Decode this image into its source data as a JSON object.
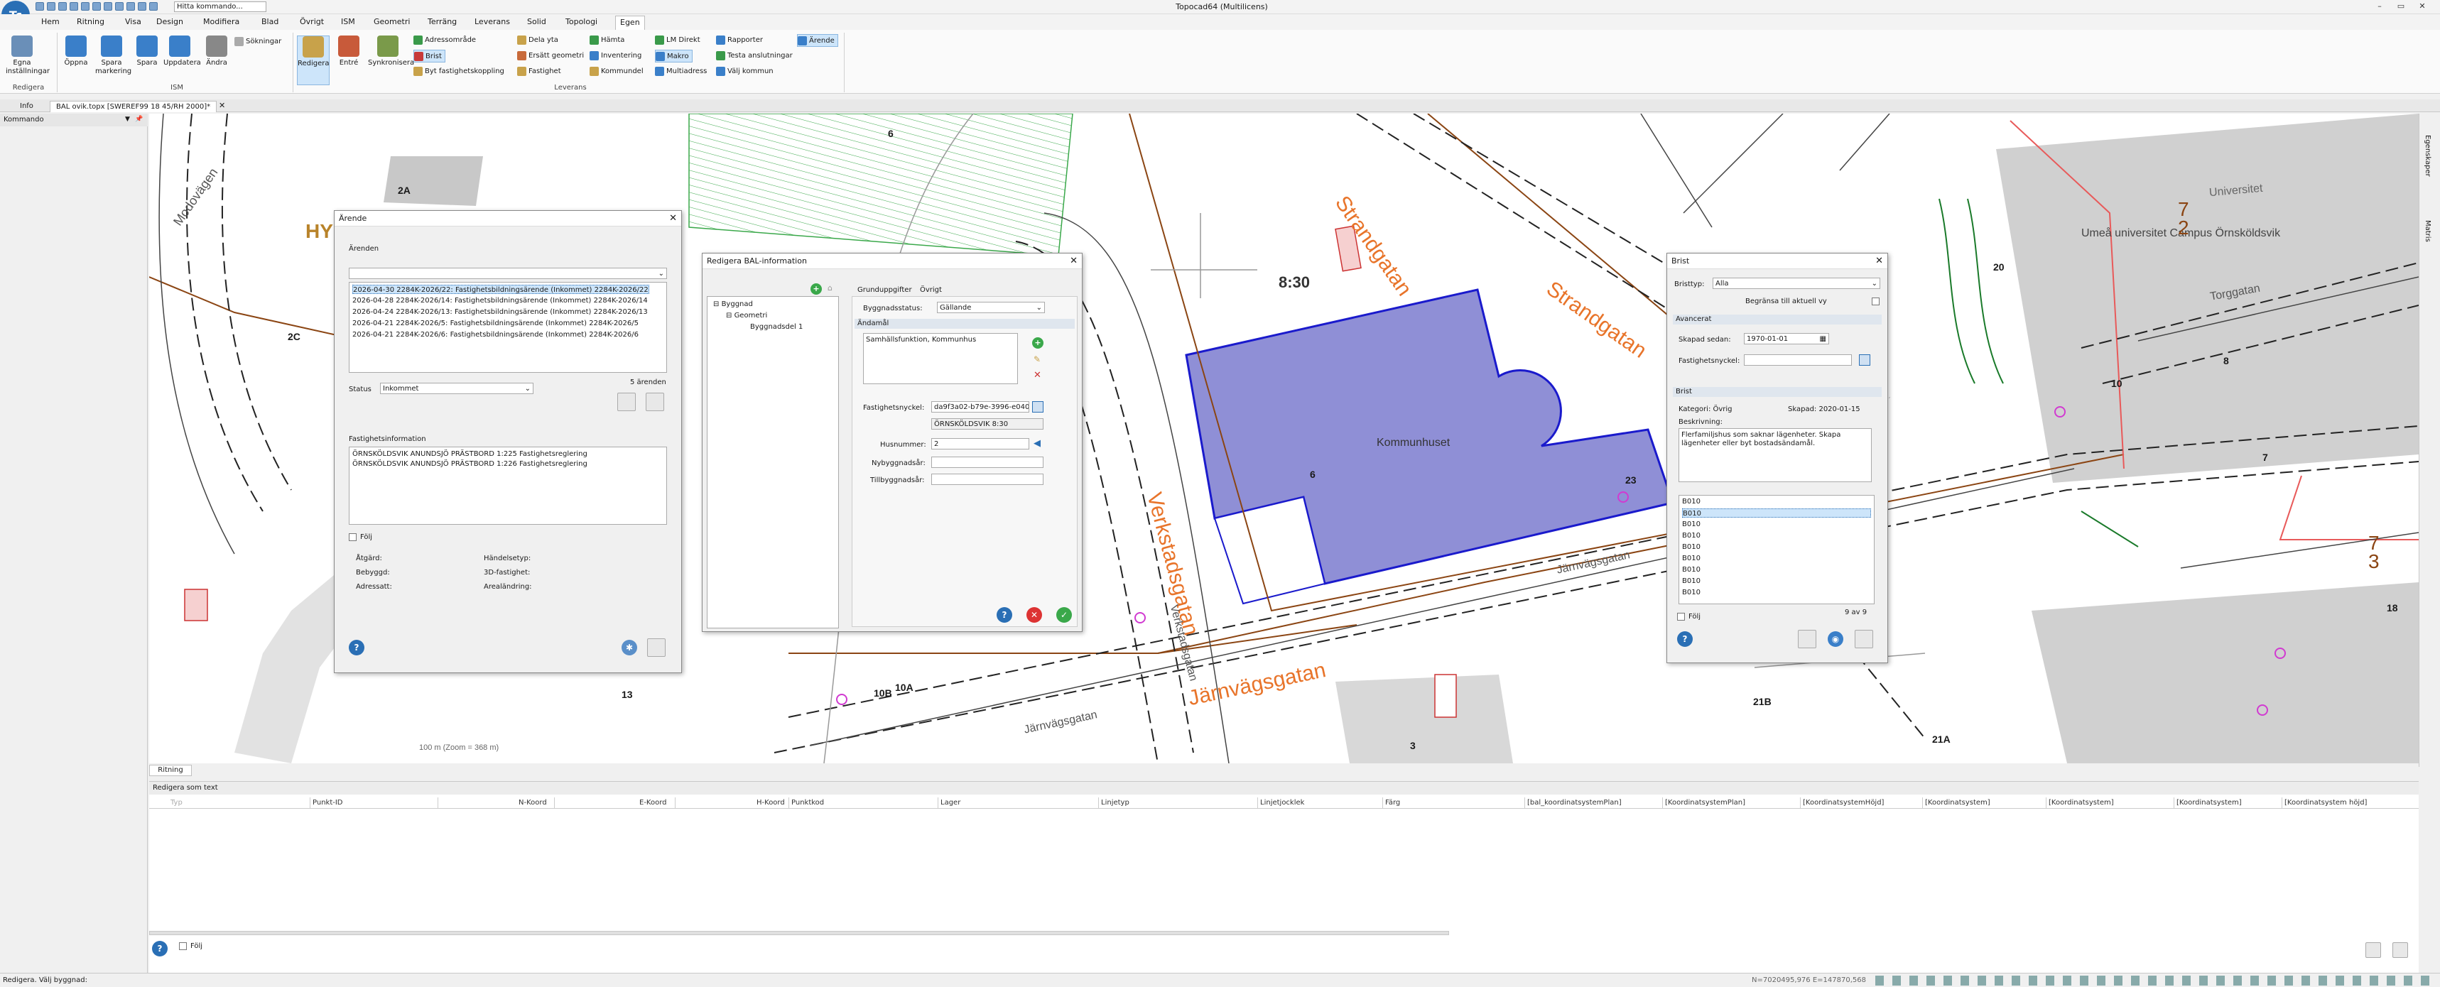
{
  "app": {
    "title": "Topocad64 (Multilicens)",
    "logo": "Tc",
    "command_placeholder": "Hitta kommando..."
  },
  "menu": [
    "Hem",
    "Ritning",
    "Visa",
    "Design",
    "Modifiera",
    "Blad",
    "Övrigt",
    "ISM",
    "Geometri",
    "Terräng",
    "Leverans",
    "Solid",
    "Topologi",
    "Egen"
  ],
  "ribbon": {
    "redigera": {
      "label": "Redigera",
      "buttons": [
        "Egna inställningar"
      ]
    },
    "ism": {
      "label": "ISM",
      "buttons": [
        "Öppna",
        "Spara markering",
        "Spara",
        "Uppdatera",
        "Ändra"
      ],
      "sokningar": "Sökningar"
    },
    "leverans": {
      "label": "Leverans",
      "big": [
        "Redigera",
        "Entré",
        "Synkronisera"
      ],
      "col1": [
        "Adressområde",
        "Brist",
        "Byt fastighetskoppling"
      ],
      "col2": [
        "Dela yta",
        "Ersätt geometri",
        "Fastighet"
      ],
      "col3": [
        "Hämta",
        "Inventering",
        "Kommundel"
      ],
      "col4": [
        "LM Direkt",
        "Makro",
        "Multiadress"
      ],
      "col5": [
        "Rapporter",
        "Testa anslutningar",
        "Välj kommun"
      ],
      "col6": [
        "Ärende"
      ]
    }
  },
  "doctabs": [
    "Info",
    "BAL ovik.topx [SWEREF99 18 45/RH 2000]*"
  ],
  "left_panel": {
    "title": "Kommando"
  },
  "right_side": [
    "Egenskaper",
    "Matris"
  ],
  "map": {
    "streets": [
      "Strandgatan",
      "Strandgatan",
      "Verkstadsgatan",
      "Verkstadsgatan",
      "Järnvägsgatan",
      "Järnvägsgatan",
      "Järnvägsgatan",
      "Torggatan",
      "Modovägen"
    ],
    "places": [
      "Kommunhuset",
      "Umeå universitet Campus Örnsköldsvik",
      "Universitet",
      "HY"
    ],
    "house_numbers": [
      "6",
      "2A",
      "2C",
      "8:30",
      "6",
      "23",
      "20",
      "10",
      "8",
      "7",
      "18",
      "13",
      "10B",
      "10A",
      "3",
      "21B",
      "21A"
    ],
    "parcels": [
      {
        "top": "7",
        "bottom": "2"
      },
      {
        "top": "7",
        "bottom": "3"
      }
    ],
    "scale": "100 m (Zoom = 368 m)"
  },
  "arende": {
    "title": "Ärende",
    "list_label": "Ärenden",
    "items": [
      "2026-04-30  2284K-2026/22: Fastighetsbildningsärende (Inkommet) 2284K-2026/22",
      "2026-04-28  2284K-2026/14: Fastighetsbildningsärende (Inkommet) 2284K-2026/14",
      "2026-04-24  2284K-2026/13: Fastighetsbildningsärende (Inkommet) 2284K-2026/13",
      "2026-04-21  2284K-2026/5: Fastighetsbildningsärende (Inkommet) 2284K-2026/5",
      "2026-04-21  2284K-2026/6: Fastighetsbildningsärende (Inkommet) 2284K-2026/6"
    ],
    "status_label": "Status",
    "status_value": "Inkommet",
    "count": "5 ärenden",
    "fastighet_label": "Fastighetsinformation",
    "fastigheter": [
      "ÖRNSKÖLDSVIK ANUNDSJÖ PRÄSTBORD 1:225 Fastighetsreglering",
      "ÖRNSKÖLDSVIK ANUNDSJÖ PRÄSTBORD 1:226 Fastighetsreglering"
    ],
    "folj": "Följ",
    "fields": [
      "Åtgärd:",
      "Bebyggd:",
      "Adressatt:"
    ],
    "fields2": [
      "Händelsetyp:",
      "3D-fastighet:",
      "Arealändring:"
    ]
  },
  "bal": {
    "title": "Redigera BAL-information",
    "tree": [
      "Byggnad",
      "Geometri",
      "Byggnadsdel 1"
    ],
    "tabs": [
      "Grunduppgifter",
      "Övrigt"
    ],
    "status_label": "Byggnadsstatus:",
    "status_value": "Gällande",
    "andamal_label": "Ändamål",
    "andamal_value": "Samhällsfunktion, Kommunhus",
    "fastnyckel_label": "Fastighetsnyckel:",
    "fastnyckel_value": "da9f3a02-b79e-3996-e040",
    "fastighet_value": "ÖRNSKÖLDSVIK 8:30",
    "husnummer_label": "Husnummer:",
    "husnummer_value": "2",
    "nybygg_label": "Nybyggnadsår:",
    "tillbygg_label": "Tillbyggnadsår:"
  },
  "brist": {
    "title": "Brist",
    "typ_label": "Bristtyp:",
    "typ_value": "Alla",
    "begransa": "Begränsa till aktuell vy",
    "avancerat": "Avancerat",
    "skapad_label": "Skapad sedan:",
    "skapad_value": "1970-01-01",
    "fastnyckel_label": "Fastighetsnyckel:",
    "brist_header": "Brist",
    "kategori": "Kategori:  Övrig",
    "skapad": "Skapad:  2020-01-15",
    "beskrivning_label": "Beskrivning:",
    "beskrivning": "Flerfamiljshus som saknar lägenheter. Skapa lägenheter eller byt bostadsändamål.",
    "items": [
      "B010",
      "B010",
      "B010",
      "B010",
      "B010",
      "B010",
      "B010",
      "B010",
      "B010"
    ],
    "count": "9 av 9",
    "folj": "Följ"
  },
  "bottom": {
    "title": "Redigera som text",
    "columns": [
      "Typ",
      "Punkt-ID",
      "N-Koord",
      "E-Koord",
      "H-Koord",
      "Punktkod",
      "Lager",
      "Linjetyp",
      "Linjetjocklek",
      "Färg",
      "[bal_koordinatsystemPlan]",
      "[KoordinatsystemPlan]",
      "[KoordinatsystemHöjd]",
      "[Koordinatsystem]",
      "[Koordinatsystem]",
      "[Koordinatsystem]",
      "[Koordinatsystem höjd]"
    ],
    "folj": "Följ",
    "tab": "Ritning"
  },
  "status": {
    "left": "Redigera. Välj byggnad:",
    "coords": "N=7020495,976 E=147870,568"
  },
  "colors": {
    "accent": "#2a6fb5",
    "building": "#8f8fd6",
    "outline": "#1a1acc",
    "street_label": "#e8742a",
    "property_line": "#8b4513"
  }
}
